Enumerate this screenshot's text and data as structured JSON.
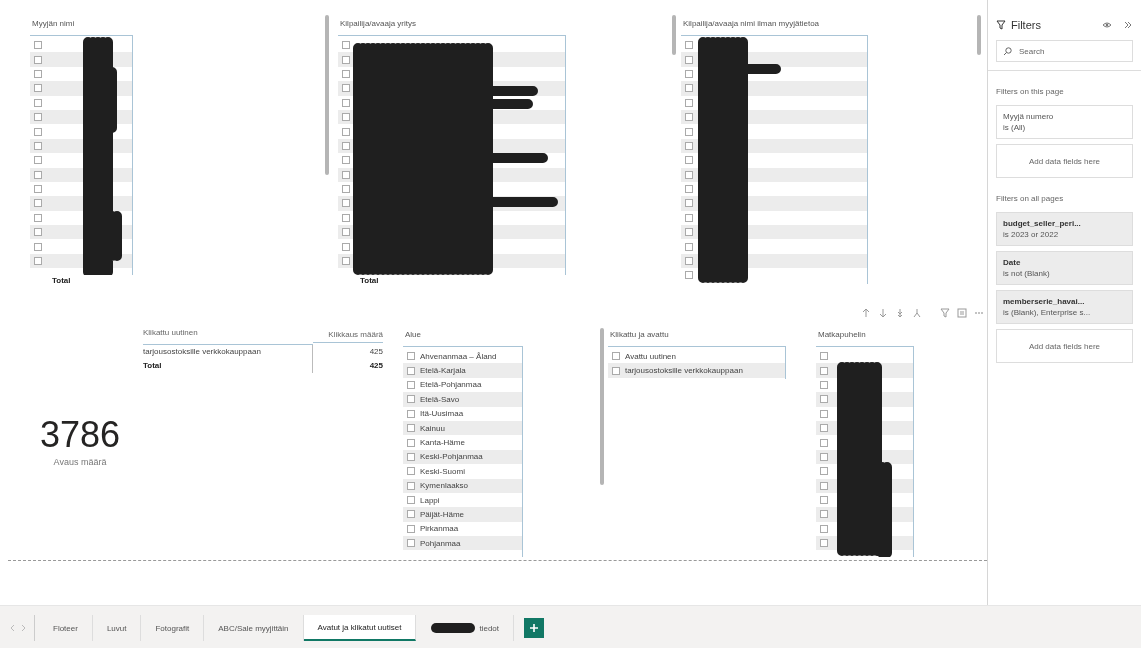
{
  "report": {
    "visuals": [
      {
        "kind": "slicer",
        "title": "Myyjän nimi",
        "redacted": true,
        "header_visible": false,
        "total": "Total",
        "rows": [
          {
            "checked": false
          },
          {
            "checked": false
          },
          {
            "checked": false
          },
          {
            "checked": false
          },
          {
            "checked": false
          },
          {
            "checked": false
          },
          {
            "checked": false
          },
          {
            "checked": false
          },
          {
            "checked": false
          },
          {
            "checked": false
          },
          {
            "checked": false
          },
          {
            "checked": false
          },
          {
            "checked": false
          },
          {
            "checked": false
          },
          {
            "checked": false
          },
          {
            "checked": false
          }
        ]
      },
      {
        "kind": "slicer",
        "title": "Kilpailija/avaaja yritys",
        "redacted": true,
        "header_visible": false,
        "total": "Total",
        "rows": [
          {
            "checked": false
          },
          {
            "checked": false
          },
          {
            "checked": false
          },
          {
            "checked": false
          },
          {
            "checked": false
          },
          {
            "checked": false
          },
          {
            "checked": false
          },
          {
            "checked": false
          },
          {
            "checked": false
          },
          {
            "checked": false
          },
          {
            "checked": false
          },
          {
            "checked": false
          },
          {
            "checked": false
          },
          {
            "checked": false
          },
          {
            "checked": false
          },
          {
            "checked": false
          }
        ]
      },
      {
        "kind": "slicer",
        "title": "Kilpailija/avaaja nimi ilman myyjätietoa",
        "redacted": true,
        "header_visible": false,
        "rows": [
          {
            "checked": false
          },
          {
            "checked": false
          },
          {
            "checked": false
          },
          {
            "checked": false
          },
          {
            "checked": false
          },
          {
            "checked": false
          },
          {
            "checked": false
          },
          {
            "checked": false
          },
          {
            "checked": false
          },
          {
            "checked": false
          },
          {
            "checked": false
          },
          {
            "checked": false
          },
          {
            "checked": false
          },
          {
            "checked": false
          },
          {
            "checked": false
          },
          {
            "checked": false
          },
          {
            "checked": false
          }
        ]
      },
      {
        "kind": "card",
        "value": "3786",
        "label": "Avaus määrä"
      },
      {
        "kind": "table",
        "columns": [
          "Klikattu uutinen",
          "Klikkaus määrä"
        ],
        "rows": [
          [
            "tarjousostoksille verkkokauppaan",
            "425"
          ]
        ],
        "total": [
          "Total",
          "425"
        ]
      },
      {
        "kind": "slicer",
        "title": "Alue",
        "redacted": false,
        "header_visible": false,
        "rows": [
          {
            "label": "Ahvenanmaa – Åland",
            "checked": false
          },
          {
            "label": "Etelä-Karjala",
            "checked": false
          },
          {
            "label": "Etelä-Pohjanmaa",
            "checked": false
          },
          {
            "label": "Etelä-Savo",
            "checked": false
          },
          {
            "label": "Itä-Uusimaa",
            "checked": false
          },
          {
            "label": "Kainuu",
            "checked": false
          },
          {
            "label": "Kanta-Häme",
            "checked": false
          },
          {
            "label": "Keski-Pohjanmaa",
            "checked": false
          },
          {
            "label": "Keski-Suomi",
            "checked": false
          },
          {
            "label": "Kymenlaakso",
            "checked": false
          },
          {
            "label": "Lappi",
            "checked": false
          },
          {
            "label": "Päijät-Häme",
            "checked": false
          },
          {
            "label": "Pirkanmaa",
            "checked": false
          },
          {
            "label": "Pohjanmaa",
            "checked": false
          }
        ]
      },
      {
        "kind": "slicer",
        "title": "Klikattu ja avattu",
        "redacted": false,
        "header_visible": false,
        "rows": [
          {
            "label": "Avattu uutinen",
            "checked": false
          },
          {
            "label": "tarjousostoksille verkkokauppaan",
            "checked": false
          }
        ]
      },
      {
        "kind": "slicer",
        "title": "Matkapuhelin",
        "redacted": true,
        "header_visible": true,
        "rows": [
          {
            "checked": false
          },
          {
            "checked": false
          },
          {
            "checked": false
          },
          {
            "checked": false
          },
          {
            "checked": false
          },
          {
            "checked": false
          },
          {
            "checked": false
          },
          {
            "checked": false
          },
          {
            "checked": false
          },
          {
            "checked": false
          },
          {
            "checked": false
          },
          {
            "checked": false
          },
          {
            "checked": false
          },
          {
            "checked": false
          }
        ]
      }
    ]
  },
  "filters": {
    "title": "Filters",
    "search": {
      "placeholder": "Search"
    },
    "page_section": {
      "title": "Filters on this page",
      "cards": [
        {
          "field": "Myyjä numero",
          "condition": "is (All)"
        }
      ],
      "add": "Add data fields here"
    },
    "all_section": {
      "title": "Filters on all pages",
      "cards": [
        {
          "field": "budget_seller_peri...",
          "condition": "is 2023 or 2022"
        },
        {
          "field": "Date",
          "condition": "is not (Blank)"
        },
        {
          "field": "memberserie_havai...",
          "condition": "is (Blank), Enterprise s..."
        }
      ],
      "add": "Add data fields here"
    }
  },
  "page_tabs": [
    {
      "label": "Floteer",
      "selected": false,
      "redacted": false
    },
    {
      "label": "Luvut",
      "selected": false,
      "redacted": false
    },
    {
      "label": "Fotografit",
      "selected": false,
      "redacted": false
    },
    {
      "label": "ABC/Sale myyjittäin",
      "selected": false,
      "redacted": false
    },
    {
      "label": "Avatut ja klikatut uutiset",
      "selected": true,
      "redacted": false
    },
    {
      "label": "tiedot",
      "selected": false,
      "redacted": true
    }
  ]
}
